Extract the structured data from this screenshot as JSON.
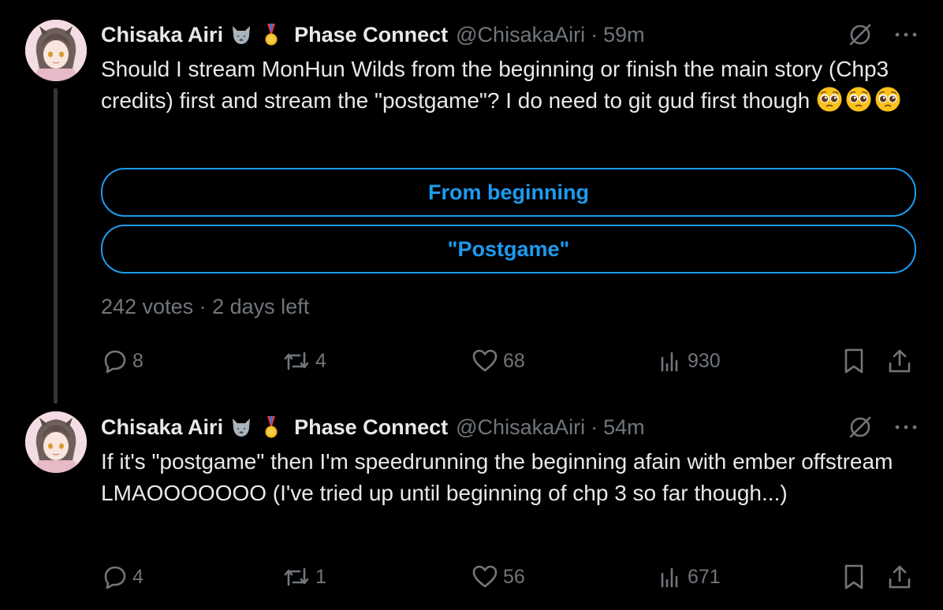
{
  "tweets": [
    {
      "display_name": "Chisaka Airi",
      "badge_icons": [
        "wolf-emoji",
        "medal-emoji"
      ],
      "affiliation": "Phase Connect",
      "handle": "@ChisakaAiri",
      "separator": "·",
      "time": "59m",
      "text": "Should I stream MonHun Wilds from the beginning or finish the main story (Chp3 credits) first and stream the \"postgame\"? I do need to git gud first though ",
      "text_emoji": [
        "pleading-face-emoji",
        "pleading-face-emoji",
        "pleading-face-emoji"
      ],
      "poll": {
        "options": [
          "From beginning",
          "\"Postgame\""
        ],
        "votes": "242 votes",
        "separator": "·",
        "time_left": "2 days left"
      },
      "metrics": {
        "replies": "8",
        "reposts": "4",
        "likes": "68",
        "views": "930"
      }
    },
    {
      "display_name": "Chisaka Airi",
      "badge_icons": [
        "wolf-emoji",
        "medal-emoji"
      ],
      "affiliation": "Phase Connect",
      "handle": "@ChisakaAiri",
      "separator": "·",
      "time": "54m",
      "text": "If it's \"postgame\" then I'm speedrunning the beginning afain with ember offstream LMAOOOOOOO (I've tried up until beginning of chp 3 so far though...)",
      "metrics": {
        "replies": "4",
        "reposts": "1",
        "likes": "56",
        "views": "671"
      }
    }
  ],
  "colors": {
    "background": "#000000",
    "text": "#e7e9ea",
    "muted": "#71767b",
    "accent": "#1d9bf0",
    "thread_line": "#333639"
  }
}
